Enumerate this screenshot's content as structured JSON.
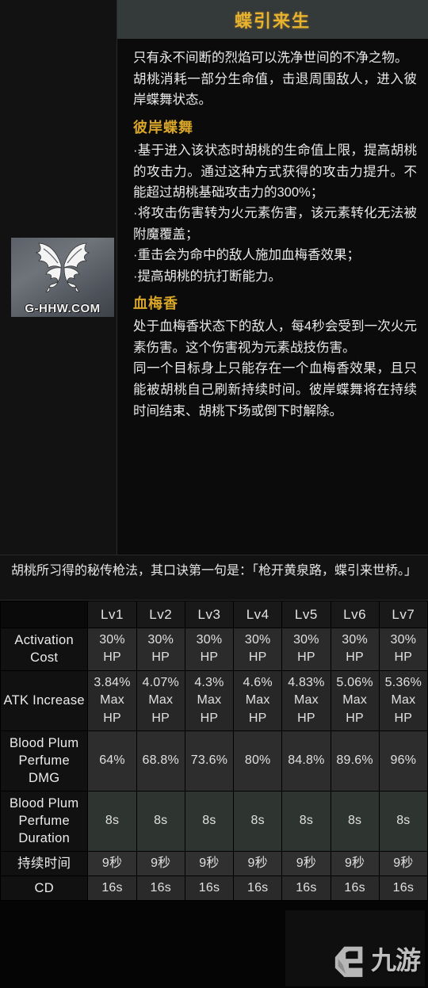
{
  "skill": {
    "title": "蝶引来生",
    "icon_label": "butterfly-icon",
    "icon_watermark": "G-HHW.COM",
    "description_paragraphs": [
      "只有永不间断的烈焰可以洗净世间的不净之物。",
      "胡桃消耗一部分生命值，击退周围敌人，进入彼岸蝶舞状态。"
    ],
    "sections": [
      {
        "heading": "彼岸蝶舞",
        "bullets": [
          "·基于进入该状态时胡桃的生命值上限，提高胡桃的攻击力。通过这种方式获得的攻击力提升。不能超过胡桃基础攻击力的300%；",
          "·将攻击伤害转为火元素伤害，该元素转化无法被附魔覆盖；",
          "·重击会为命中的敌人施加血梅香效果；",
          "·提高胡桃的抗打断能力。"
        ]
      },
      {
        "heading": "血梅香",
        "paragraphs": [
          "处于血梅香状态下的敌人，每4秒会受到一次火元素伤害。这个伤害视为元素战技伤害。",
          "同一个目标身上只能存在一个血梅香效果，且只能被胡桃自己刷新持续时间。彼岸蝶舞将在持续时间结束、胡桃下场或倒下时解除。"
        ]
      }
    ],
    "quote": "胡桃所习得的秘传枪法，其口诀第一句是：「枪开黄泉路，蝶引来世桥。」"
  },
  "table": {
    "corner_label": "",
    "level_headers": [
      "Lv1",
      "Lv2",
      "Lv3",
      "Lv4",
      "Lv5",
      "Lv6",
      "Lv7"
    ],
    "rows": [
      {
        "label": "Activation Cost",
        "tone": "tone-a",
        "values": [
          "30% HP",
          "30% HP",
          "30% HP",
          "30% HP",
          "30% HP",
          "30% HP",
          "30% HP"
        ],
        "value_parts": [
          [
            "30%",
            "HP"
          ],
          [
            "30%",
            "HP"
          ],
          [
            "30%",
            "HP"
          ],
          [
            "30%",
            "HP"
          ],
          [
            "30%",
            "HP"
          ],
          [
            "30%",
            "HP"
          ],
          [
            "30%",
            "HP"
          ]
        ]
      },
      {
        "label": "ATK Increase",
        "tone": "tone-b",
        "values": [
          "3.84% Max HP",
          "4.07% Max HP",
          "4.3% Max HP",
          "4.6% Max HP",
          "4.83% Max HP",
          "5.06% Max HP",
          "5.36% Max HP"
        ],
        "value_parts": [
          [
            "3.84%",
            "Max",
            "HP"
          ],
          [
            "4.07%",
            "Max",
            "HP"
          ],
          [
            "4.3%",
            "Max",
            "HP"
          ],
          [
            "4.6%",
            "Max",
            "HP"
          ],
          [
            "4.83%",
            "Max",
            "HP"
          ],
          [
            "5.06%",
            "Max",
            "HP"
          ],
          [
            "5.36%",
            "Max",
            "HP"
          ]
        ]
      },
      {
        "label": "Blood Plum Perfume DMG",
        "tone": "tone-c",
        "values": [
          "64%",
          "68.8%",
          "73.6%",
          "80%",
          "84.8%",
          "89.6%",
          "96%"
        ],
        "value_parts": [
          [
            "64%"
          ],
          [
            "68.8%"
          ],
          [
            "73.6%"
          ],
          [
            "80%"
          ],
          [
            "84.8%"
          ],
          [
            "89.6%"
          ],
          [
            "96%"
          ]
        ]
      },
      {
        "label": "Blood Plum Perfume Duration",
        "tone": "tone-green",
        "values": [
          "8s",
          "8s",
          "8s",
          "8s",
          "8s",
          "8s",
          "8s"
        ],
        "value_parts": [
          [
            "8s"
          ],
          [
            "8s"
          ],
          [
            "8s"
          ],
          [
            "8s"
          ],
          [
            "8s"
          ],
          [
            "8s"
          ],
          [
            "8s"
          ]
        ]
      },
      {
        "label": "持续时间",
        "tone": "tone-d",
        "values": [
          "9秒",
          "9秒",
          "9秒",
          "9秒",
          "9秒",
          "9秒",
          "9秒"
        ],
        "value_parts": [
          [
            "9秒"
          ],
          [
            "9秒"
          ],
          [
            "9秒"
          ],
          [
            "9秒"
          ],
          [
            "9秒"
          ],
          [
            "9秒"
          ],
          [
            "9秒"
          ]
        ]
      },
      {
        "label": "CD",
        "tone": "tone-e",
        "values": [
          "16s",
          "16s",
          "16s",
          "16s",
          "16s",
          "16s",
          "16s"
        ],
        "value_parts": [
          [
            "16s"
          ],
          [
            "16s"
          ],
          [
            "16s"
          ],
          [
            "16s"
          ],
          [
            "16s"
          ],
          [
            "16s"
          ],
          [
            "16s"
          ]
        ]
      }
    ]
  },
  "watermark": {
    "text": "九游",
    "logo": "g-logo-icon"
  },
  "colors": {
    "title_gold": "#e8b22e",
    "section_heading_gold": "#d9a62a",
    "body_text": "#e9e9e9",
    "page_bg": "#0b0b0b",
    "title_bar_bg": "#34393a",
    "duration_row_bg": "#2e3531"
  }
}
